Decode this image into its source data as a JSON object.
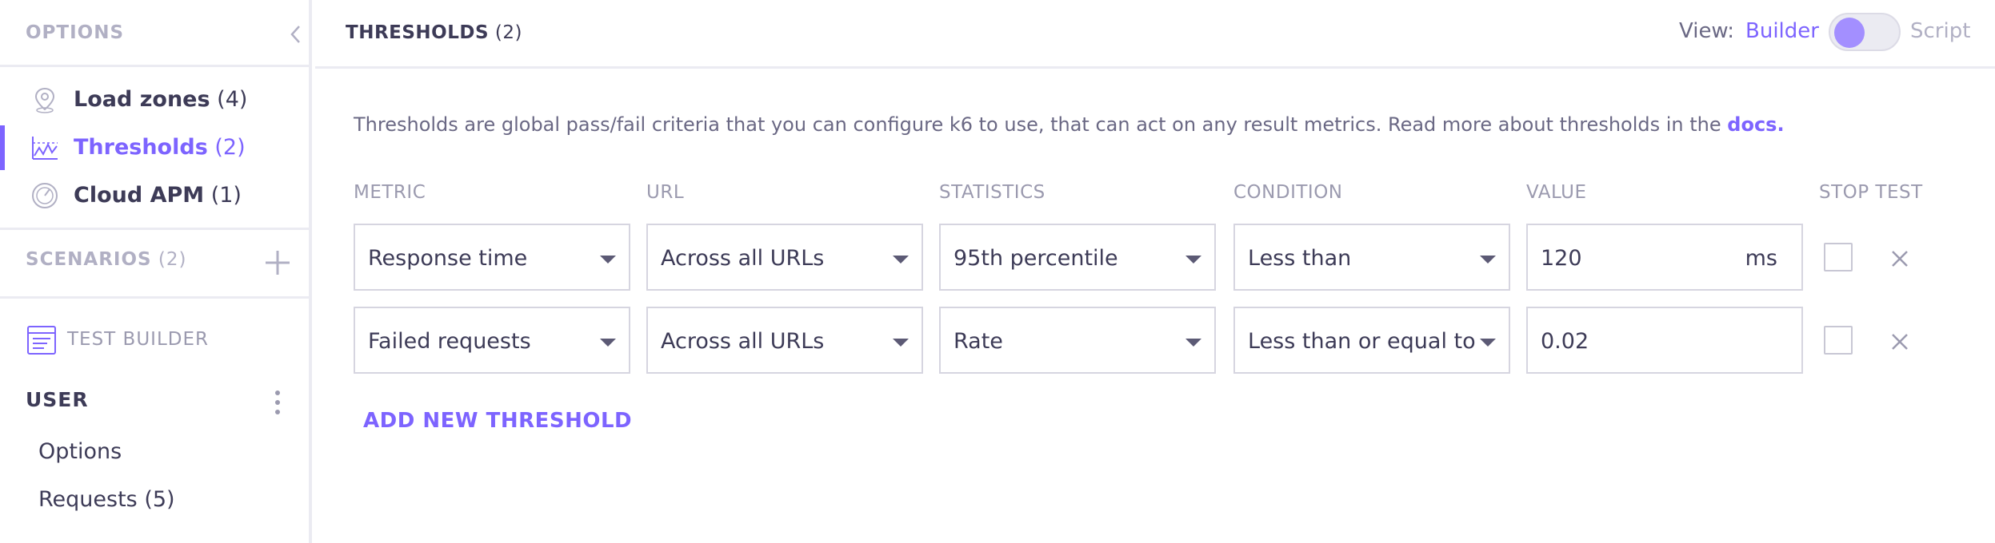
{
  "sidebar": {
    "title": "OPTIONS",
    "items": [
      {
        "label": "Load zones",
        "count": "(4)",
        "icon": "location-pin-icon"
      },
      {
        "label": "Thresholds",
        "count": "(2)",
        "icon": "threshold-chart-icon"
      },
      {
        "label": "Cloud APM",
        "count": "(1)",
        "icon": "gauge-icon"
      }
    ],
    "scenarios": {
      "label": "SCENARIOS",
      "count": "(2)"
    },
    "test_builder": {
      "label": "TEST BUILDER"
    },
    "user": {
      "label": "USER",
      "items": [
        "Options",
        "Requests (5)"
      ]
    }
  },
  "header": {
    "title": "THRESHOLDS",
    "count": "(2)",
    "view_label": "View:",
    "view_builder": "Builder",
    "view_script": "Script",
    "toggle_state": "builder"
  },
  "main": {
    "description_text": "Thresholds are global pass/fail criteria that you can configure k6 to use, that can act on any result metrics. Read more about thresholds in the ",
    "description_link": "docs.",
    "columns": [
      "METRIC",
      "URL",
      "STATISTICS",
      "CONDITION",
      "VALUE",
      "STOP TEST"
    ],
    "rows": [
      {
        "metric": "Response time",
        "url": "Across all URLs",
        "statistics": "95th percentile",
        "condition": "Less than",
        "value": "120",
        "unit": "ms",
        "stop_test": false
      },
      {
        "metric": "Failed requests",
        "url": "Across all URLs",
        "statistics": "Rate",
        "condition": "Less than or equal to",
        "value": "0.02",
        "unit": "",
        "stop_test": false
      }
    ],
    "add_button": "ADD NEW THRESHOLD"
  },
  "colors": {
    "accent": "#7d64ff",
    "text": "#3d3b57",
    "muted": "#b1b0c4",
    "border": "#d6d5e0"
  }
}
